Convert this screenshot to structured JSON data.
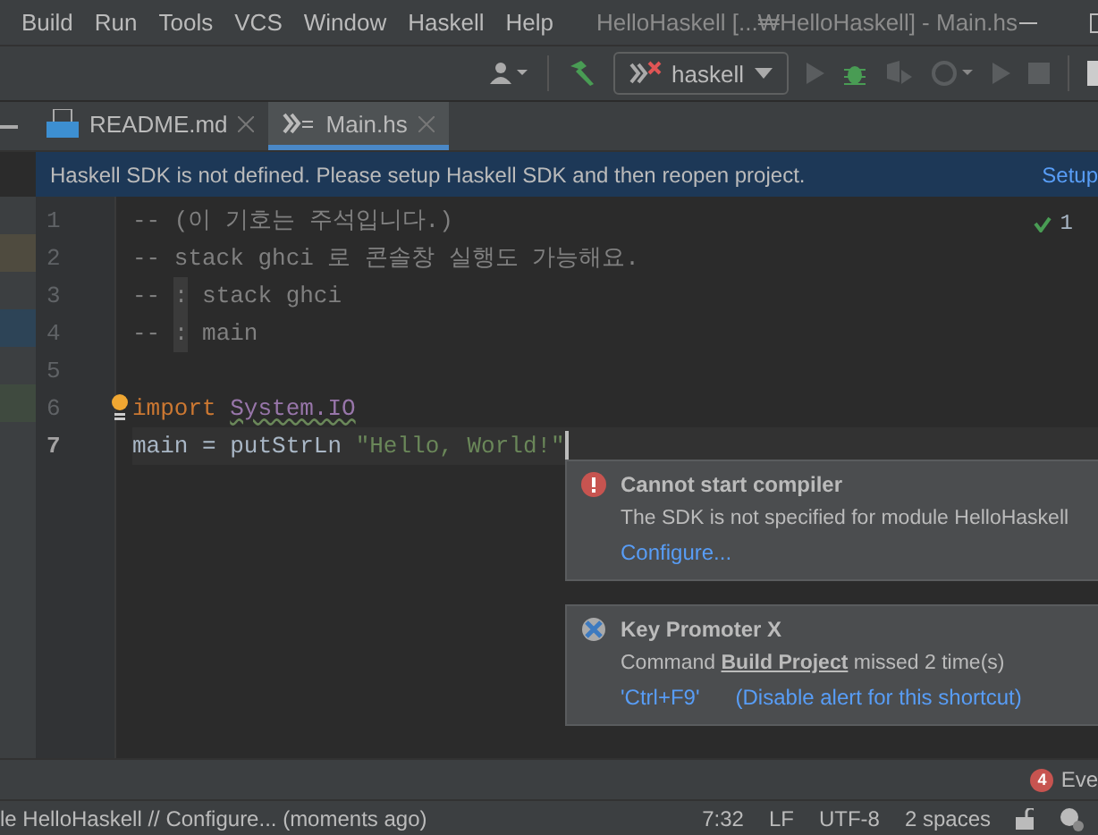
{
  "menu": [
    "Build",
    "Run",
    "Tools",
    "VCS",
    "Window",
    "Haskell",
    "Help"
  ],
  "window": {
    "title": "HelloHaskell [...₩HelloHaskell] - Main.hs"
  },
  "toolbar": {
    "run_config": "haskell"
  },
  "tabs": [
    {
      "label": "README.md",
      "kind": "markdown",
      "selected": false
    },
    {
      "label": "Main.hs",
      "kind": "haskell",
      "selected": true
    }
  ],
  "banner": {
    "message": "Haskell SDK is not defined. Please setup Haskell SDK and then reopen project.",
    "action": "Setup"
  },
  "editor": {
    "inspection": "1",
    "lines": [
      {
        "number": "1",
        "current": false,
        "tokens": [
          {
            "kind": "comment",
            "text": "-- (이 기호는 주석입니다.)"
          }
        ]
      },
      {
        "number": "2",
        "current": false,
        "tokens": [
          {
            "kind": "comment",
            "text": "-- stack ghci 로 콘솔창 실행도 가능해요."
          }
        ]
      },
      {
        "number": "3",
        "current": false,
        "tokens": [
          {
            "kind": "comment",
            "text": "-- "
          },
          {
            "kind": "marker",
            "text": ":"
          },
          {
            "kind": "comment",
            "text": " stack ghci"
          }
        ]
      },
      {
        "number": "4",
        "current": false,
        "tokens": [
          {
            "kind": "comment",
            "text": "-- "
          },
          {
            "kind": "marker",
            "text": ":"
          },
          {
            "kind": "comment",
            "text": " main"
          }
        ]
      },
      {
        "number": "5",
        "current": false
      },
      {
        "number": "6",
        "current": false,
        "tokens": [
          {
            "kind": "keyword",
            "text": "import "
          },
          {
            "kind": "module",
            "text": "System.IO"
          }
        ]
      },
      {
        "number": "7",
        "current": true,
        "tokens": [
          {
            "kind": "plain",
            "text": "main = putStrLn "
          },
          {
            "kind": "string",
            "text": "\"Hello, World!\""
          }
        ]
      }
    ]
  },
  "notifications": [
    {
      "kind": "error",
      "title": "Cannot start compiler",
      "body": "The SDK is not specified for module HelloHaskell",
      "links": [
        "Configure..."
      ]
    },
    {
      "kind": "promoter",
      "title": "Key Promoter X",
      "body": "Command **Build Project** missed 2 time(s)",
      "links": [
        "'Ctrl+F9'",
        "(Disable alert for this shortcut)"
      ]
    }
  ],
  "event_log": {
    "count": "4",
    "label": "Eve"
  },
  "status_bar": {
    "message": "le HelloHaskell // Configure... (moments ago)",
    "items": [
      "7:32",
      "LF",
      "UTF-8",
      "2 spaces"
    ]
  }
}
